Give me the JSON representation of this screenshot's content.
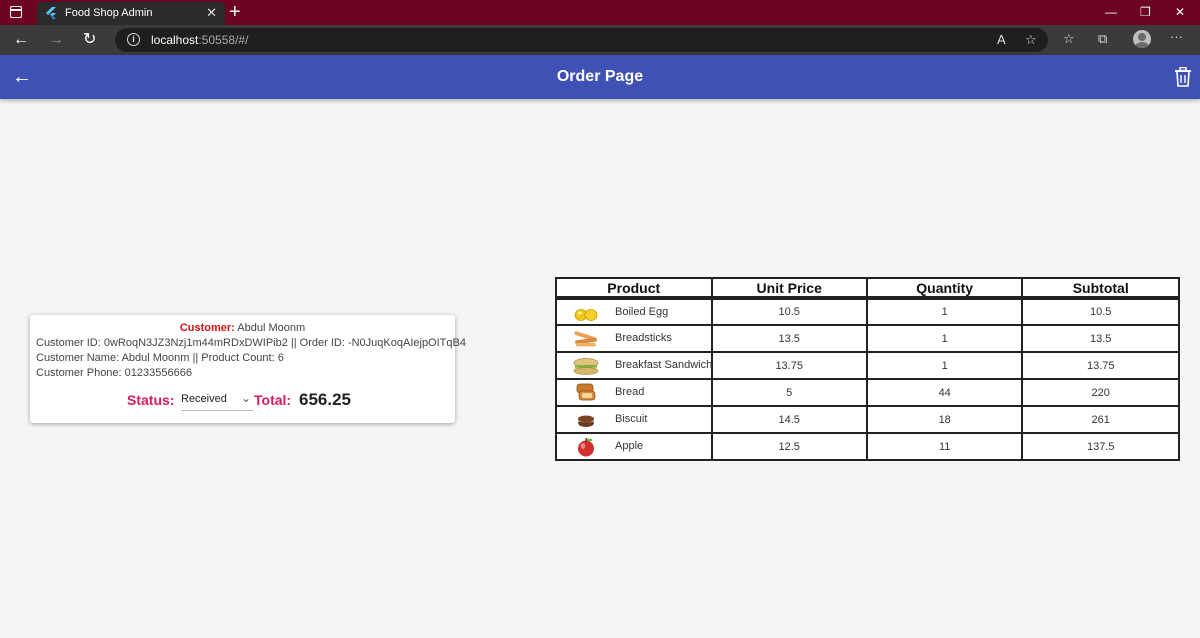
{
  "browser": {
    "tab_title": "Food Shop Admin",
    "url_host": "localhost",
    "url_rest": ":50558/#/"
  },
  "appbar": {
    "title": "Order Page"
  },
  "order": {
    "customer_label": "Customer:",
    "customer_name": "Abdul Moonm",
    "id_line": "Customer ID: 0wRoqN3JZ3Nzj1m44mRDxDWIPib2 || Order ID: -N0JuqKoqAIejpOITqB4",
    "name_line": "Customer Name: Abdul Moonm || Product Count: 6",
    "phone_line": "Customer Phone: 01233556666",
    "status_label": "Status:",
    "status_value": "Received",
    "total_label": "Total:",
    "total_value": "656.25"
  },
  "table": {
    "headers": [
      "Product",
      "Unit Price",
      "Quantity",
      "Subtotal"
    ],
    "rows": [
      {
        "name": "Boiled Egg",
        "icon": "boiled-egg",
        "unit_price": "10.5",
        "quantity": "1",
        "subtotal": "10.5"
      },
      {
        "name": "Breadsticks",
        "icon": "breadsticks",
        "unit_price": "13.5",
        "quantity": "1",
        "subtotal": "13.5"
      },
      {
        "name": "Breakfast Sandwich",
        "icon": "sandwich",
        "unit_price": "13.75",
        "quantity": "1",
        "subtotal": "13.75"
      },
      {
        "name": "Bread",
        "icon": "bread",
        "unit_price": "5",
        "quantity": "44",
        "subtotal": "220"
      },
      {
        "name": "Biscuit",
        "icon": "biscuit",
        "unit_price": "14.5",
        "quantity": "18",
        "subtotal": "261"
      },
      {
        "name": "Apple",
        "icon": "apple",
        "unit_price": "12.5",
        "quantity": "11",
        "subtotal": "137.5"
      }
    ]
  },
  "colors": {
    "appbar": "#3f51b5",
    "tabbar": "#6b0522",
    "accent_pink": "#d81b60",
    "customer_red": "#d21313"
  }
}
